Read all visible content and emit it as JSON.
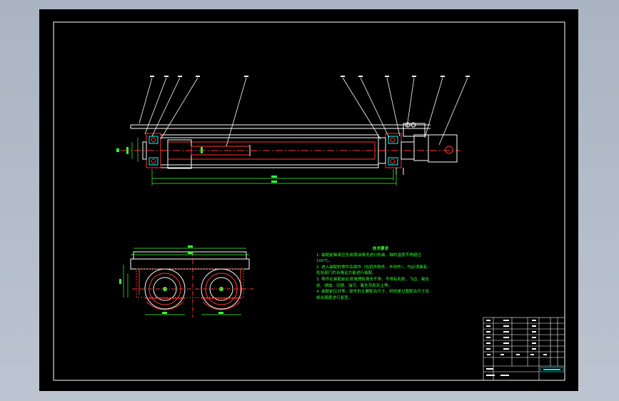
{
  "technical_requirements": {
    "title": "技术要求",
    "items": [
      "1. 装配前轴承应先用煤油清洗进行热装，轴的温度不得超过100℃。",
      "2. 进入装配的零件及部件（包括外购件、外协件），均必须具有检验部门的合格证方能进行装配。",
      "3. 零件在装配前必须清理和清洗干净，不得有毛刺、飞边、氧化皮、锈蚀、切屑、油污、着色剂和灰尘等。",
      "4. 装配前应对零、部件的主要配合尺寸，特别是过盈配合尺寸及相关精度进行复查。"
    ]
  },
  "colors": {
    "sheet": "#000000",
    "outline": "#ffffff",
    "parts": "#ff3333",
    "dimensions": "#33ff33",
    "title_block": "#00ffff",
    "leaders": "#ffffff"
  }
}
